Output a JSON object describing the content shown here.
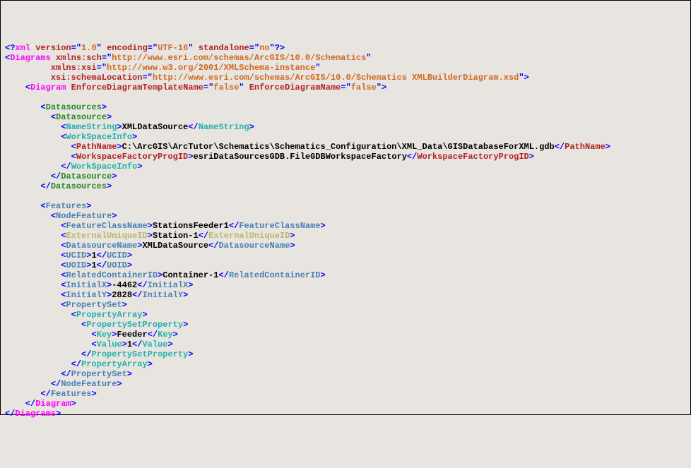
{
  "xml_decl": {
    "version": "1.0",
    "encoding": "UTF-16",
    "standalone": "no"
  },
  "root": {
    "tag": "Diagrams",
    "xmlns_sch": "http://www.esri.com/schemas/ArcGIS/10.0/Schematics",
    "xmlns_xsi": "http://www.w3.org/2001/XMLSchema-instance",
    "xsi_schemaLocation": "http://www.esri.com/schemas/ArcGIS/10.0/Schematics XMLBuilderDiagram.xsd"
  },
  "diagram": {
    "tag": "Diagram",
    "EnforceDiagramTemplateName": "false",
    "EnforceDiagramName": "false"
  },
  "datasources_tag": "Datasources",
  "datasource_tag": "Datasource",
  "namestring": {
    "tag": "NameString",
    "value": "XMLDataSource"
  },
  "workspaceinfo_tag": "WorkSpaceInfo",
  "pathname": {
    "tag": "PathName",
    "value": "C:\\ArcGIS\\ArcTutor\\Schematics\\Schematics_Configuration\\XML_Data\\GISDatabaseForXML.gdb"
  },
  "wfpid": {
    "tag": "WorkspaceFactoryProgID",
    "value": "esriDataSourcesGDB.FileGDBWorkspaceFactory"
  },
  "features_tag": "Features",
  "nodefeature_tag": "NodeFeature",
  "featureclassname": {
    "tag": "FeatureClassName",
    "value": "StationsFeeder1"
  },
  "externaluniqueid": {
    "tag": "ExternalUniqueID",
    "value": "Station-1"
  },
  "datasourcename": {
    "tag": "DatasourceName",
    "value": "XMLDataSource"
  },
  "ucid": {
    "tag": "UCID",
    "value": "1"
  },
  "uoid": {
    "tag": "UOID",
    "value": "1"
  },
  "relatedcontainerid": {
    "tag": "RelatedContainerID",
    "value": "Container-1"
  },
  "initialx": {
    "tag": "InitialX",
    "value": "-4462"
  },
  "initialy": {
    "tag": "InitialY",
    "value": "2828"
  },
  "propertyset_tag": "PropertySet",
  "propertyarray_tag": "PropertyArray",
  "propertysetproperty_tag": "PropertySetProperty",
  "key": {
    "tag": "Key",
    "value": "Feeder"
  },
  "value": {
    "tag": "Value",
    "value": "1"
  }
}
